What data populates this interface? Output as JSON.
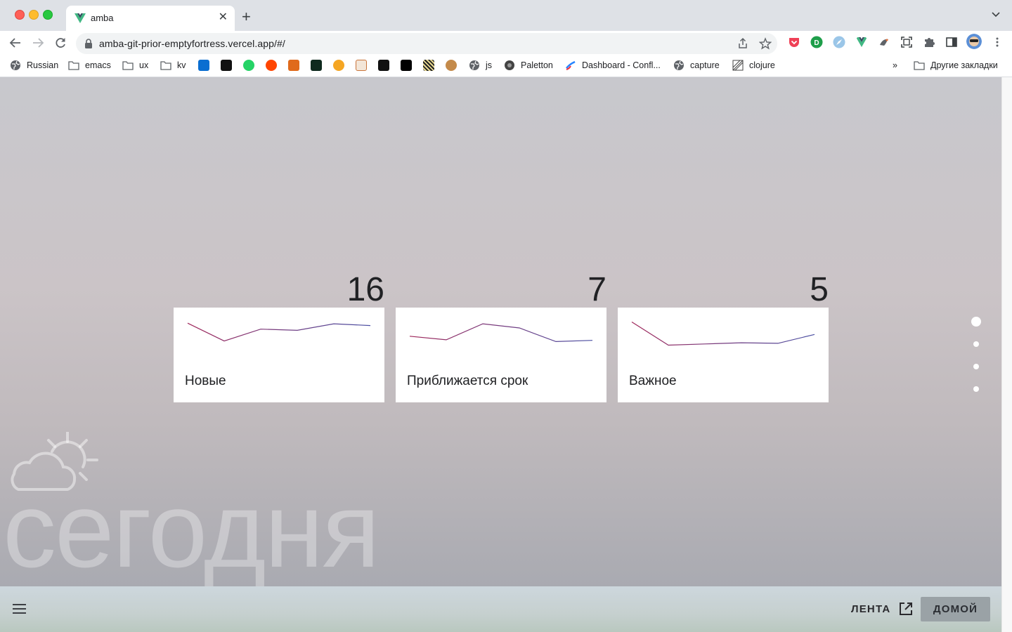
{
  "browser": {
    "tab_title": "amba",
    "url": "amba-git-prior-emptyfortress.vercel.app/#/",
    "new_tab_label": "+",
    "close_label": "✕",
    "bookmarks": [
      {
        "label": "Russian",
        "icon": "globe-icon"
      },
      {
        "label": "emacs",
        "icon": "folder-icon"
      },
      {
        "label": "ux",
        "icon": "folder-icon"
      },
      {
        "label": "kv",
        "icon": "folder-icon"
      },
      {
        "label": "js",
        "icon": "globe-icon"
      },
      {
        "label": "Paletton",
        "icon": "paletton-icon"
      },
      {
        "label": "Dashboard - Confl...",
        "icon": "confluence-icon"
      },
      {
        "label": "capture",
        "icon": "globe-icon"
      },
      {
        "label": "clojure",
        "icon": "clojure-icon"
      }
    ],
    "more_bookmarks": "»",
    "other_bookmarks": "Другие закладки"
  },
  "page": {
    "cards": [
      {
        "label": "Новые",
        "count": "16"
      },
      {
        "label": "Приближается срок",
        "count": "7"
      },
      {
        "label": "Важное",
        "count": "5"
      }
    ],
    "today_label": "сегодня",
    "pager_active_index": 0,
    "pager_count": 4
  },
  "bottom_bar": {
    "feed_label": "ЛЕНТА",
    "home_label": "ДОМОЙ"
  },
  "colors": {
    "sparkline_start": "#a0275a",
    "sparkline_end": "#4a4fa3",
    "card_bg": "#ffffff"
  },
  "chart_data": [
    {
      "type": "line",
      "values": [
        5,
        2,
        4,
        3.8,
        4.9,
        4.6
      ]
    },
    {
      "type": "line",
      "values": [
        2.8,
        2.2,
        4.9,
        4.2,
        1.9,
        2.1
      ]
    },
    {
      "type": "line",
      "values": [
        5.2,
        1.3,
        1.5,
        1.7,
        1.6,
        3.1
      ]
    }
  ]
}
